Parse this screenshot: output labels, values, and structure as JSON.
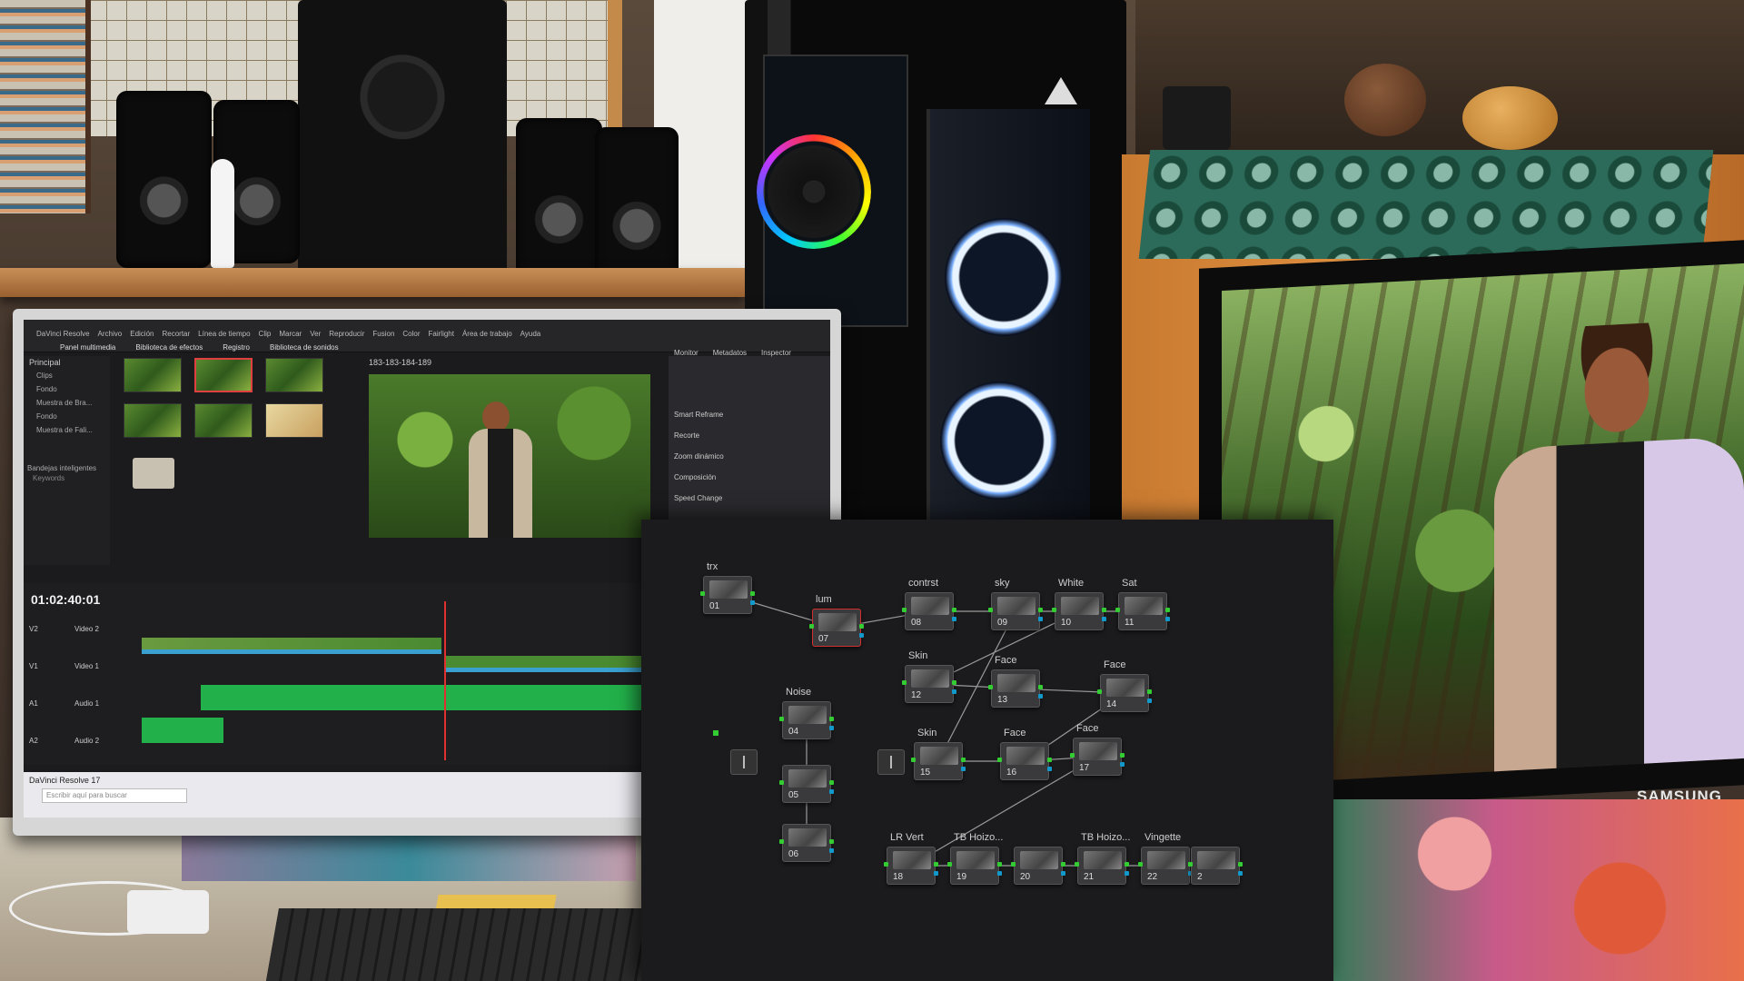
{
  "resolve_app": {
    "menu": [
      "DaVinci Resolve",
      "Archivo",
      "Edición",
      "Recortar",
      "Línea de tiempo",
      "Clip",
      "Marcar",
      "Ver",
      "Reproducir",
      "Fusion",
      "Color",
      "Fairlight",
      "Área de trabajo",
      "Ayuda"
    ],
    "toolbar": [
      "Panel multimedia",
      "Biblioteca de efectos",
      "Registro",
      "Biblioteca de sonidos"
    ],
    "bin_label": "Principal",
    "bin_items": [
      "Clips",
      "Fondo",
      "Muestra de Bra...",
      "Fondo",
      "Muestra de Fali..."
    ],
    "smart_bins": "Bandejas inteligentes",
    "keywords": "Keywords",
    "clip_name": "183-183-184-189",
    "timecode": "01:02:40:01",
    "inspector_tabs": [
      "Monitor",
      "Metadatos",
      "Inspector"
    ],
    "inspector_sections": [
      "Smart Reframe",
      "Recorte",
      "Zoom dinámico",
      "Composición",
      "Speed Change"
    ],
    "tracks": [
      "V2",
      "Video 2",
      "V1",
      "Video 1",
      "A1",
      "Audio 1",
      "A2",
      "Audio 2"
    ],
    "app_title": "DaVinci Resolve 17",
    "search_placeholder": "Escribir aquí para buscar"
  },
  "node_graph": {
    "nodes": [
      {
        "num": "01",
        "label": "trx"
      },
      {
        "num": "07",
        "label": "lum"
      },
      {
        "num": "08",
        "label": "contrst"
      },
      {
        "num": "09",
        "label": "sky"
      },
      {
        "num": "10",
        "label": "White"
      },
      {
        "num": "11",
        "label": "Sat"
      },
      {
        "num": "12",
        "label": "Skin"
      },
      {
        "num": "13",
        "label": "Face"
      },
      {
        "num": "14",
        "label": "Face"
      },
      {
        "num": "04",
        "label": "Noise"
      },
      {
        "num": "05",
        "label": ""
      },
      {
        "num": "06",
        "label": ""
      },
      {
        "num": "15",
        "label": "Skin"
      },
      {
        "num": "16",
        "label": "Face"
      },
      {
        "num": "17",
        "label": "Face"
      },
      {
        "num": "18",
        "label": "LR Vert"
      },
      {
        "num": "19",
        "label": "TB Hoizo..."
      },
      {
        "num": "20",
        "label": ""
      },
      {
        "num": "21",
        "label": "TB Hoizo..."
      },
      {
        "num": "22",
        "label": "Vingette"
      },
      {
        "num": "2",
        "label": ""
      }
    ]
  },
  "tv": {
    "brand": "SAMSUNG"
  },
  "colors": {
    "node_pin": "#33cc33",
    "output_pin": "#1199cc",
    "playhead": "#e03030",
    "audio_clip": "#22b04a"
  }
}
